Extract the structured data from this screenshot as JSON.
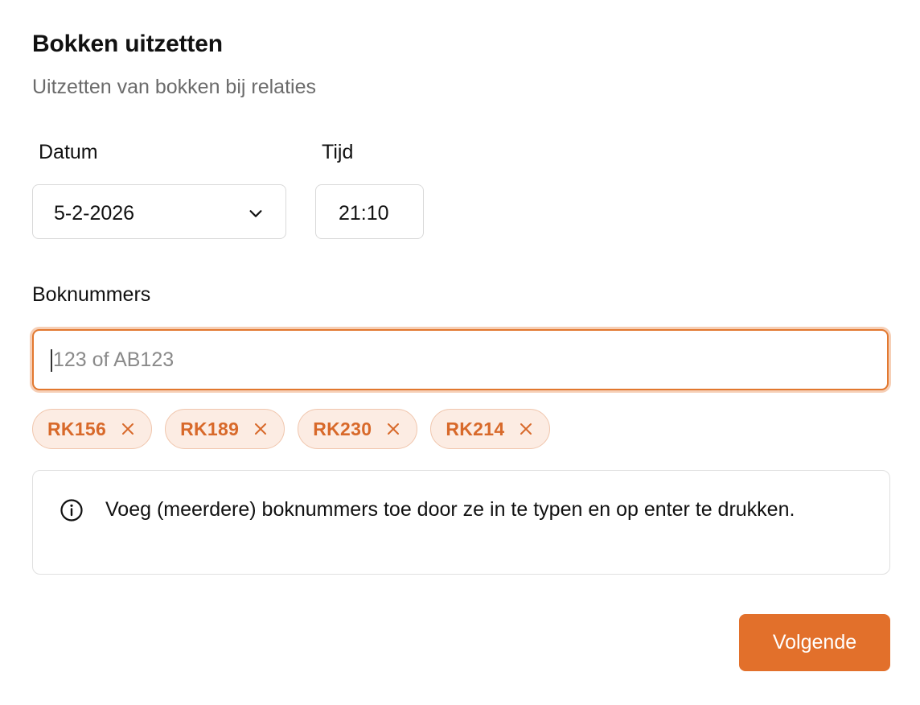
{
  "header": {
    "title": "Bokken uitzetten",
    "subtitle": "Uitzetten van bokken bij relaties"
  },
  "form": {
    "date_label": "Datum",
    "date_value": "5-2-2026",
    "time_label": "Tijd",
    "time_value": "21:10",
    "boknummers_label": "Boknummers",
    "boknummers_placeholder": "123 of AB123",
    "boknummers_value": ""
  },
  "chips": [
    {
      "label": "RK156"
    },
    {
      "label": "RK189"
    },
    {
      "label": "RK230"
    },
    {
      "label": "RK214"
    }
  ],
  "info": {
    "icon": "info-icon",
    "text": "Voeg (meerdere) boknummers toe door ze in te typen en op enter te drukken."
  },
  "actions": {
    "next_label": "Volgende"
  },
  "colors": {
    "accent": "#e2702b",
    "chip_bg": "#fcece3",
    "chip_text": "#d8692a",
    "focus_ring": "#f6cfb6"
  }
}
